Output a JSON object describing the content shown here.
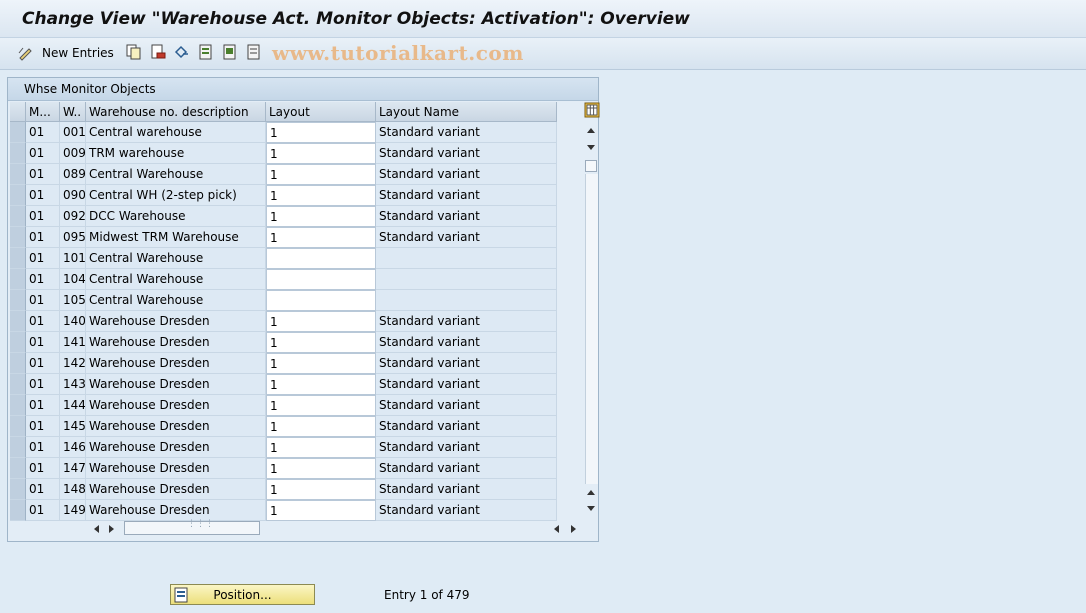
{
  "window": {
    "title": "Change View \"Warehouse Act. Monitor Objects: Activation\": Overview"
  },
  "toolbar": {
    "new_entries_label": "New Entries",
    "icons": [
      "edit-pencil-icon",
      "copy-icon",
      "delete-icon",
      "undo-icon",
      "select-all-icon",
      "select-block-icon",
      "deselect-all-icon"
    ],
    "watermark": "www.tutorialkart.com"
  },
  "table": {
    "title": "Whse Monitor Objects",
    "columns": [
      "M...",
      "W..",
      "Warehouse no. description",
      "Layout",
      "Layout Name"
    ],
    "rows": [
      {
        "m": "01",
        "w": "001",
        "desc": "Central warehouse",
        "layout": "1",
        "layout_name": "Standard variant"
      },
      {
        "m": "01",
        "w": "009",
        "desc": "TRM warehouse",
        "layout": "1",
        "layout_name": "Standard variant"
      },
      {
        "m": "01",
        "w": "089",
        "desc": "Central Warehouse",
        "layout": "1",
        "layout_name": "Standard variant"
      },
      {
        "m": "01",
        "w": "090",
        "desc": "Central WH (2-step pick)",
        "layout": "1",
        "layout_name": "Standard variant"
      },
      {
        "m": "01",
        "w": "092",
        "desc": "DCC Warehouse",
        "layout": "1",
        "layout_name": "Standard variant"
      },
      {
        "m": "01",
        "w": "095",
        "desc": "Midwest TRM Warehouse",
        "layout": "1",
        "layout_name": "Standard variant"
      },
      {
        "m": "01",
        "w": "101",
        "desc": "Central Warehouse",
        "layout": "",
        "layout_name": ""
      },
      {
        "m": "01",
        "w": "104",
        "desc": "Central Warehouse",
        "layout": "",
        "layout_name": ""
      },
      {
        "m": "01",
        "w": "105",
        "desc": "Central Warehouse",
        "layout": "",
        "layout_name": ""
      },
      {
        "m": "01",
        "w": "140",
        "desc": "Warehouse Dresden",
        "layout": "1",
        "layout_name": "Standard variant"
      },
      {
        "m": "01",
        "w": "141",
        "desc": "Warehouse Dresden",
        "layout": "1",
        "layout_name": "Standard variant"
      },
      {
        "m": "01",
        "w": "142",
        "desc": "Warehouse Dresden",
        "layout": "1",
        "layout_name": "Standard variant"
      },
      {
        "m": "01",
        "w": "143",
        "desc": "Warehouse Dresden",
        "layout": "1",
        "layout_name": "Standard variant"
      },
      {
        "m": "01",
        "w": "144",
        "desc": "Warehouse Dresden",
        "layout": "1",
        "layout_name": "Standard variant"
      },
      {
        "m": "01",
        "w": "145",
        "desc": "Warehouse Dresden",
        "layout": "1",
        "layout_name": "Standard variant"
      },
      {
        "m": "01",
        "w": "146",
        "desc": "Warehouse Dresden",
        "layout": "1",
        "layout_name": "Standard variant"
      },
      {
        "m": "01",
        "w": "147",
        "desc": "Warehouse Dresden",
        "layout": "1",
        "layout_name": "Standard variant"
      },
      {
        "m": "01",
        "w": "148",
        "desc": "Warehouse Dresden",
        "layout": "1",
        "layout_name": "Standard variant"
      },
      {
        "m": "01",
        "w": "149",
        "desc": "Warehouse Dresden",
        "layout": "1",
        "layout_name": "Standard variant"
      }
    ]
  },
  "footer": {
    "position_button_label": "Position...",
    "entry_info": "Entry 1 of 479"
  },
  "colors": {
    "background": "#dfebf5",
    "position_button": "#f3ea9f"
  }
}
